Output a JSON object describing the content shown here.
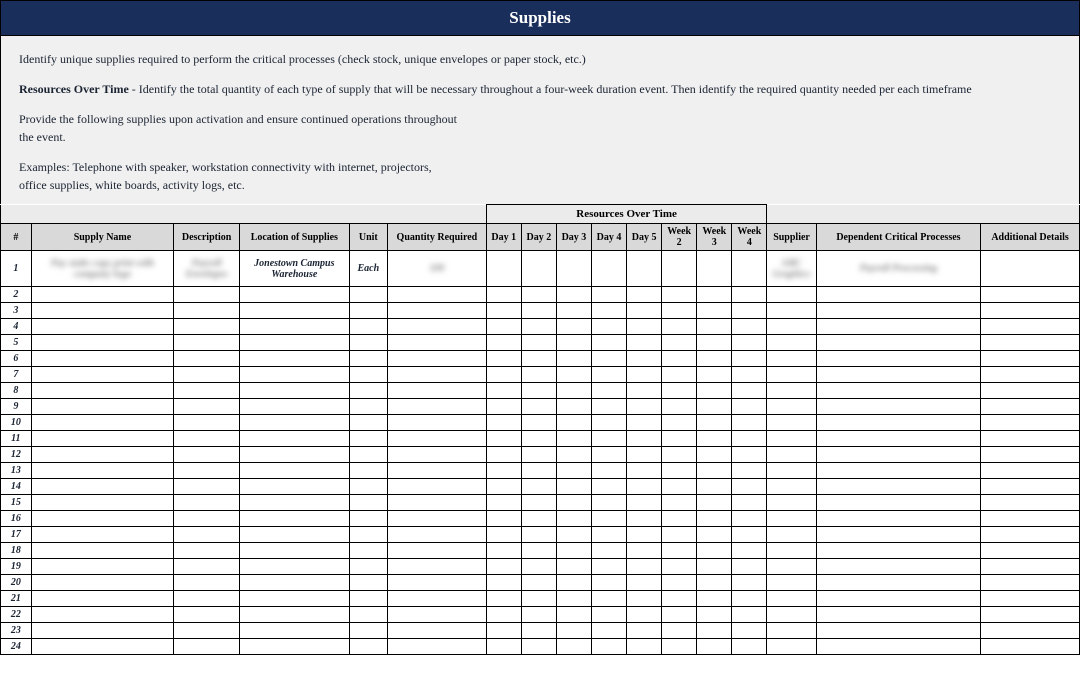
{
  "title": "Supplies",
  "intro": {
    "p1": "Identify unique supplies required to perform the critical processes (check stock, unique envelopes or paper stock, etc.)",
    "p2_bold": "Resources Over Time",
    "p2_rest": " - Identify the total quantity of each type of supply that will be necessary throughout a four-week duration event. Then identify the required quantity needed per each timeframe",
    "p3a": "Provide the following supplies upon activation and ensure continued operations throughout",
    "p3b": "the event.",
    "p4a": "Examples: Telephone with speaker, workstation connectivity with internet, projectors,",
    "p4b": "office supplies, white boards, activity logs, etc."
  },
  "headers": {
    "resources_over_time": "Resources Over Time",
    "num": "#",
    "supply_name": "Supply Name",
    "description": "Description",
    "location": "Location of Supplies",
    "unit": "Unit",
    "qty": "Quantity Required",
    "day1": "Day 1",
    "day2": "Day 2",
    "day3": "Day 3",
    "day4": "Day 4",
    "day5": "Day 5",
    "week2": "Week 2",
    "week3": "Week 3",
    "week4": "Week 4",
    "supplier": "Supplier",
    "dep": "Dependent Critical Processes",
    "additional": "Additional Details"
  },
  "rows": [
    {
      "num": "1",
      "supply_name": "Pay stubs copy print with company logo",
      "description": "Payroll Envelopes",
      "location": "Jonestown Campus Warehouse",
      "unit": "Each",
      "qty": "100",
      "supplier": "ABC Graphics",
      "dep": "Payroll Processing"
    },
    {
      "num": "2"
    },
    {
      "num": "3"
    },
    {
      "num": "4"
    },
    {
      "num": "5"
    },
    {
      "num": "6"
    },
    {
      "num": "7"
    },
    {
      "num": "8"
    },
    {
      "num": "9"
    },
    {
      "num": "10"
    },
    {
      "num": "11"
    },
    {
      "num": "12"
    },
    {
      "num": "13"
    },
    {
      "num": "14"
    },
    {
      "num": "15"
    },
    {
      "num": "16"
    },
    {
      "num": "17"
    },
    {
      "num": "18"
    },
    {
      "num": "19"
    },
    {
      "num": "20"
    },
    {
      "num": "21"
    },
    {
      "num": "22"
    },
    {
      "num": "23"
    },
    {
      "num": "24"
    }
  ]
}
